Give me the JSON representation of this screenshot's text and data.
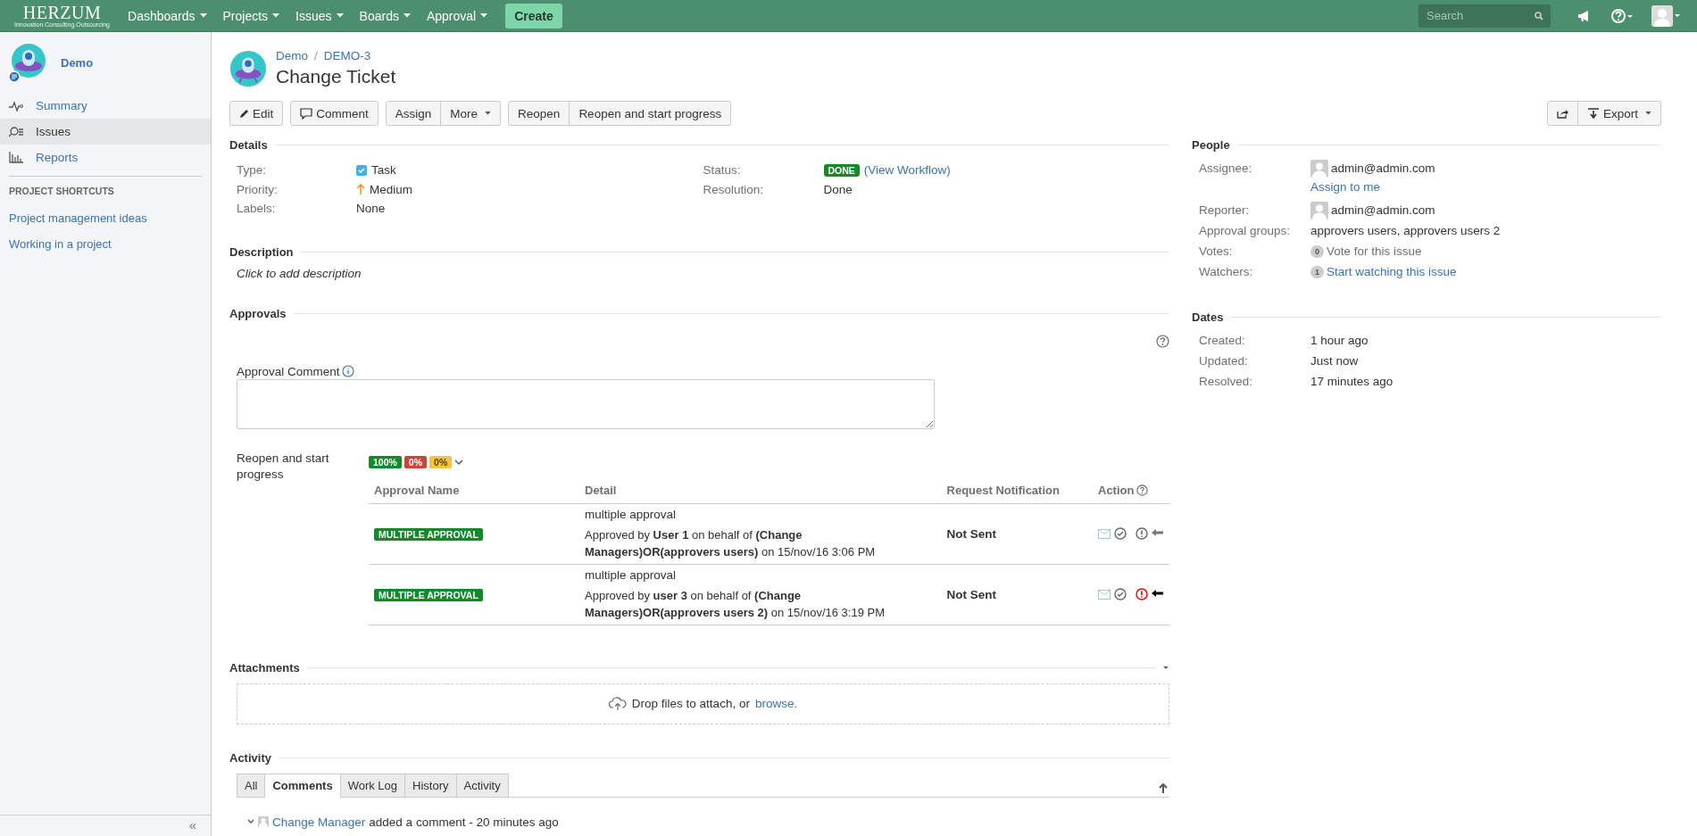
{
  "topbar": {
    "logo": "HERZUM",
    "logo_tagline": "Innovation.Consulting.Outsourcing",
    "menus": [
      {
        "label": "Dashboards"
      },
      {
        "label": "Projects"
      },
      {
        "label": "Issues"
      },
      {
        "label": "Boards"
      },
      {
        "label": "Approval"
      }
    ],
    "create": "Create",
    "search": {
      "placeholder": "Search"
    }
  },
  "sidebar": {
    "project": "Demo",
    "items": [
      {
        "label": "Summary",
        "selected": false
      },
      {
        "label": "Issues",
        "selected": true
      },
      {
        "label": "Reports",
        "selected": false
      }
    ],
    "shortcuts_heading": "PROJECT SHORTCUTS",
    "shortcuts": [
      "Project management ideas",
      "Working in a project"
    ],
    "collapse": "«"
  },
  "issue": {
    "breadcrumb": [
      "Demo",
      "DEMO-3"
    ],
    "separator": "/",
    "title": "Change Ticket",
    "toolbar": [
      [
        {
          "label": "Edit"
        }
      ],
      [
        {
          "label": "Comment"
        }
      ],
      [
        {
          "label": "Assign"
        },
        {
          "label": "More",
          "dropdown": true
        }
      ],
      [
        {
          "label": "Reopen"
        },
        {
          "label": "Reopen and start progress"
        }
      ]
    ],
    "export": "Export"
  },
  "details": {
    "heading": "Details",
    "left": [
      {
        "label": "Type:",
        "value": "Task",
        "kind": "type"
      },
      {
        "label": "Priority:",
        "value": "Medium",
        "kind": "priority"
      },
      {
        "label": "Labels:",
        "value": "None",
        "kind": "text"
      }
    ],
    "right": [
      {
        "label": "Status:",
        "value": "DONE",
        "link": "(View Workflow)",
        "kind": "status"
      },
      {
        "label": "Resolution:",
        "value": "Done",
        "kind": "text"
      }
    ]
  },
  "description": {
    "heading": "Description",
    "placeholder": "Click to add description"
  },
  "approvals": {
    "heading": "Approvals",
    "comment_label": "Approval Comment",
    "transition": "Reopen and start progress",
    "summary": [
      {
        "text": "100%",
        "color": "#14892c"
      },
      {
        "text": "0%",
        "color": "#d04437"
      },
      {
        "text": "0%",
        "color": "#f6c342"
      }
    ],
    "columns": [
      "Approval Name",
      "Detail",
      "Request Notification",
      "Action"
    ],
    "rows": [
      {
        "name": "MULTIPLE APPROVAL",
        "title": "multiple approval",
        "detail": "Approved by **User 1** on behalf of **(Change Managers)OR(approvers users)** on 15/nov/16 3:06 PM",
        "notification": "Not Sent",
        "reject_active": false
      },
      {
        "name": "MULTIPLE APPROVAL",
        "title": "multiple approval",
        "detail": "Approved by **user 3** on behalf of **(Change Managers)OR(approvers users 2)** on 15/nov/16 3:19 PM",
        "notification": "Not Sent",
        "reject_active": true
      }
    ]
  },
  "attachments": {
    "heading": "Attachments",
    "drop_text": "Drop files to attach, or",
    "browse": "browse."
  },
  "activity": {
    "heading": "Activity",
    "tabs": [
      {
        "label": "All",
        "selected": false
      },
      {
        "label": "Comments",
        "selected": true
      },
      {
        "label": "Work Log",
        "selected": false
      },
      {
        "label": "History",
        "selected": false
      },
      {
        "label": "Activity",
        "selected": false
      }
    ],
    "comment": {
      "author": "Change Manager",
      "text": "added a comment - 20 minutes ago"
    }
  },
  "people": {
    "heading": "People",
    "rows": [
      {
        "label": "Assignee:",
        "value": "admin@admin.com",
        "kind": "user",
        "link": "Assign to me"
      },
      {
        "label": "Reporter:",
        "value": "admin@admin.com",
        "kind": "user"
      },
      {
        "label": "Approval groups:",
        "value": "approvers users, approvers users 2",
        "kind": "text"
      },
      {
        "label": "Votes:",
        "count": "0",
        "value": "Vote for this issue",
        "kind": "count"
      },
      {
        "label": "Watchers:",
        "count": "1",
        "value": "Start watching this issue",
        "kind": "count-link"
      }
    ]
  },
  "dates": {
    "heading": "Dates",
    "rows": [
      {
        "label": "Created:",
        "value": "1 hour ago"
      },
      {
        "label": "Updated:",
        "value": "Just now"
      },
      {
        "label": "Resolved:",
        "value": "17 minutes ago"
      }
    ]
  }
}
